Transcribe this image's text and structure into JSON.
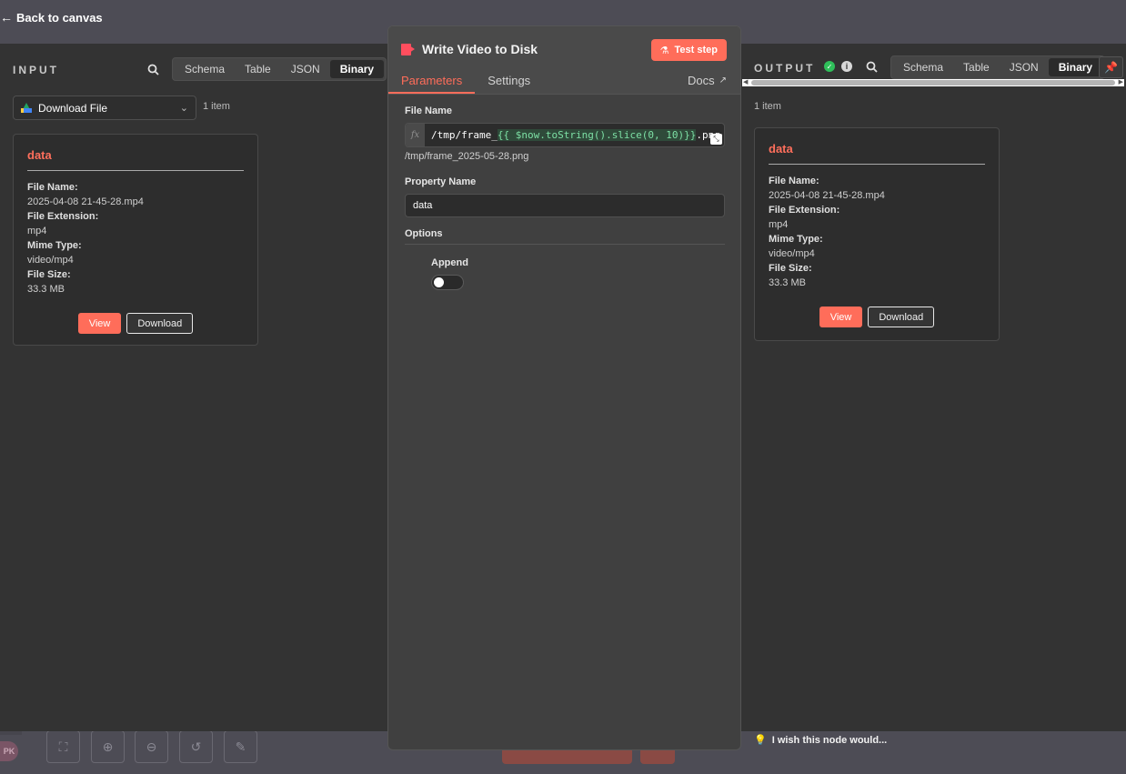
{
  "canvas": {
    "back_label": "Back to canvas",
    "avatar_initials": "PK"
  },
  "input": {
    "title": "INPUT",
    "display_modes": [
      "Schema",
      "Table",
      "JSON",
      "Binary"
    ],
    "active_mode": "Binary",
    "source_node": "Download File",
    "item_count": "1 item",
    "card": {
      "title": "data",
      "file_name_label": "File Name:",
      "file_name": "2025-04-08 21-45-28.mp4",
      "file_ext_label": "File Extension:",
      "file_ext": "mp4",
      "mime_label": "Mime Type:",
      "mime": "video/mp4",
      "size_label": "File Size:",
      "size": "33.3 MB",
      "view_label": "View",
      "download_label": "Download"
    }
  },
  "node": {
    "title": "Write Video to Disk",
    "test_label": "Test step",
    "tabs": [
      "Parameters",
      "Settings"
    ],
    "docs_label": "Docs",
    "params": {
      "file_name_label": "File Name",
      "file_name_prefix": "/tmp/frame_",
      "file_name_expr": "{{ $now.toString().slice(0, 10)}}",
      "file_name_suffix": ".png",
      "file_name_preview": "/tmp/frame_2025-05-28.png",
      "property_label": "Property Name",
      "property_value": "data",
      "options_label": "Options",
      "append_label": "Append",
      "append_enabled": false
    }
  },
  "output": {
    "title": "OUTPUT",
    "display_modes": [
      "Schema",
      "Table",
      "JSON",
      "Binary"
    ],
    "active_mode": "Binary",
    "item_count": "1 item",
    "card": {
      "title": "data",
      "file_name_label": "File Name:",
      "file_name": "2025-04-08 21-45-28.mp4",
      "file_ext_label": "File Extension:",
      "file_ext": "mp4",
      "mime_label": "Mime Type:",
      "mime": "video/mp4",
      "size_label": "File Size:",
      "size": "33.3 MB",
      "view_label": "View",
      "download_label": "Download"
    },
    "feedback_label": "I wish this node would..."
  },
  "colors": {
    "accent": "#ff6d5a",
    "success": "#2fbf5a"
  }
}
